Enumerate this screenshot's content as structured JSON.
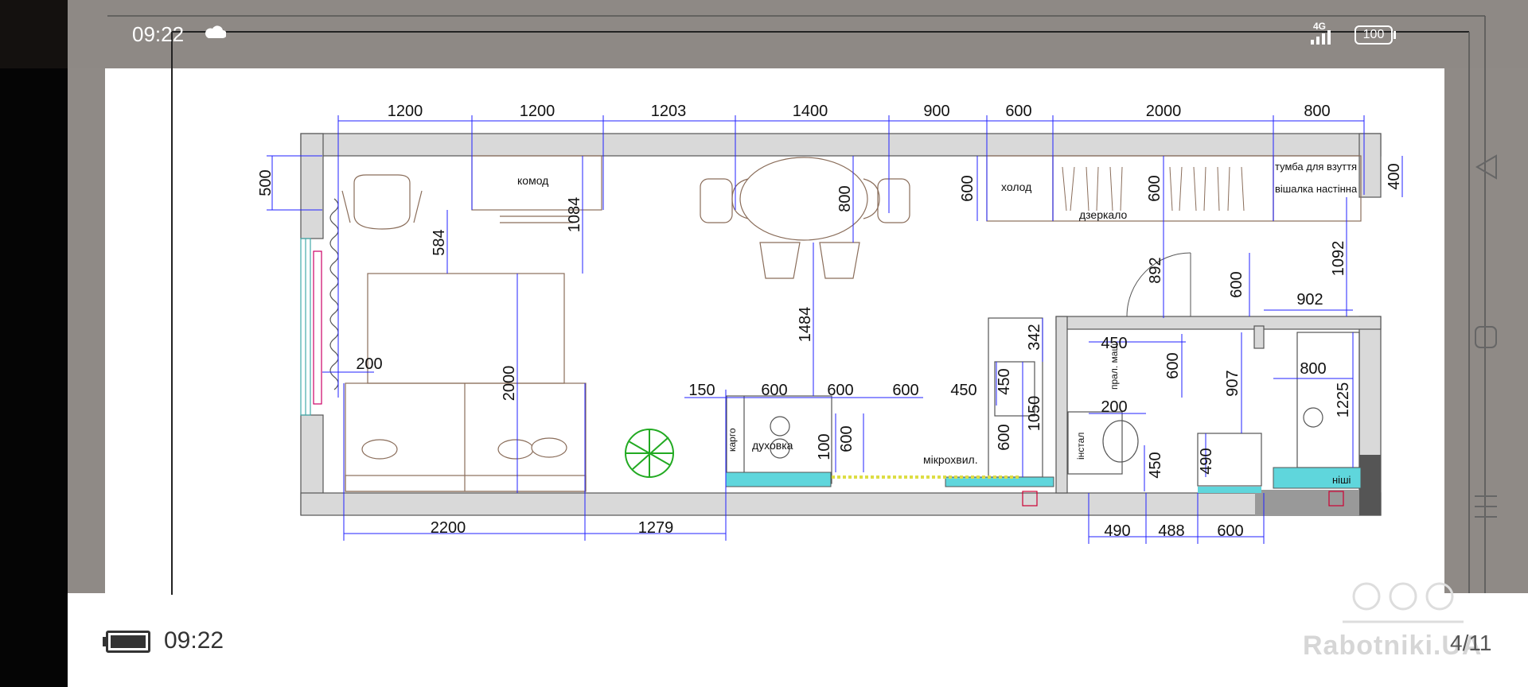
{
  "status": {
    "time": "09:22",
    "network": "4G",
    "battery": "100"
  },
  "bottom": {
    "time": "09:22",
    "page_indicator": "4/11",
    "watermark": "Rabotniki.UA"
  },
  "plan": {
    "top_dims": [
      "1200",
      "1200",
      "1203",
      "1400",
      "900",
      "600",
      "2000",
      "800"
    ],
    "dim_500": "500",
    "dim_584": "584",
    "dim_1084": "1084",
    "dim_800": "800",
    "dim_600_holod": "600",
    "dim_600_dzerk": "600",
    "dim_400": "400",
    "dim_892": "892",
    "dim_600_door": "600",
    "dim_1092": "1092",
    "dim_902": "902",
    "dim_1484": "1484",
    "dim_200_left": "200",
    "dim_2000": "2000",
    "kitchen_dims": [
      "150",
      "600",
      "600",
      "600",
      "450"
    ],
    "dim_100": "100",
    "dim_600_k1": "600",
    "dim_450_sink": "450",
    "dim_1050": "1050",
    "dim_600_k2": "600",
    "dim_342": "342",
    "bath_450": "450",
    "bath_600": "600",
    "bath_200": "200",
    "bath_907": "907",
    "bath_450b": "450",
    "bath_490": "490",
    "shower_800": "800",
    "shower_1225": "1225",
    "bottom_dims": [
      "2200",
      "1279"
    ],
    "bath_bottom_dims": [
      "490",
      "488",
      "600"
    ],
    "labels": {
      "komod": "комод",
      "holod": "холод",
      "dzerkalo": "дзеркало",
      "tumba": "тумба для взуття",
      "vishalka": "вішалка настінна",
      "kargo": "карго",
      "duhovka": "духовка",
      "mikrohvil": "мікрохвил.",
      "instal": "інстал",
      "pral_mash": "прал. маш",
      "nishi": "ніші"
    }
  }
}
